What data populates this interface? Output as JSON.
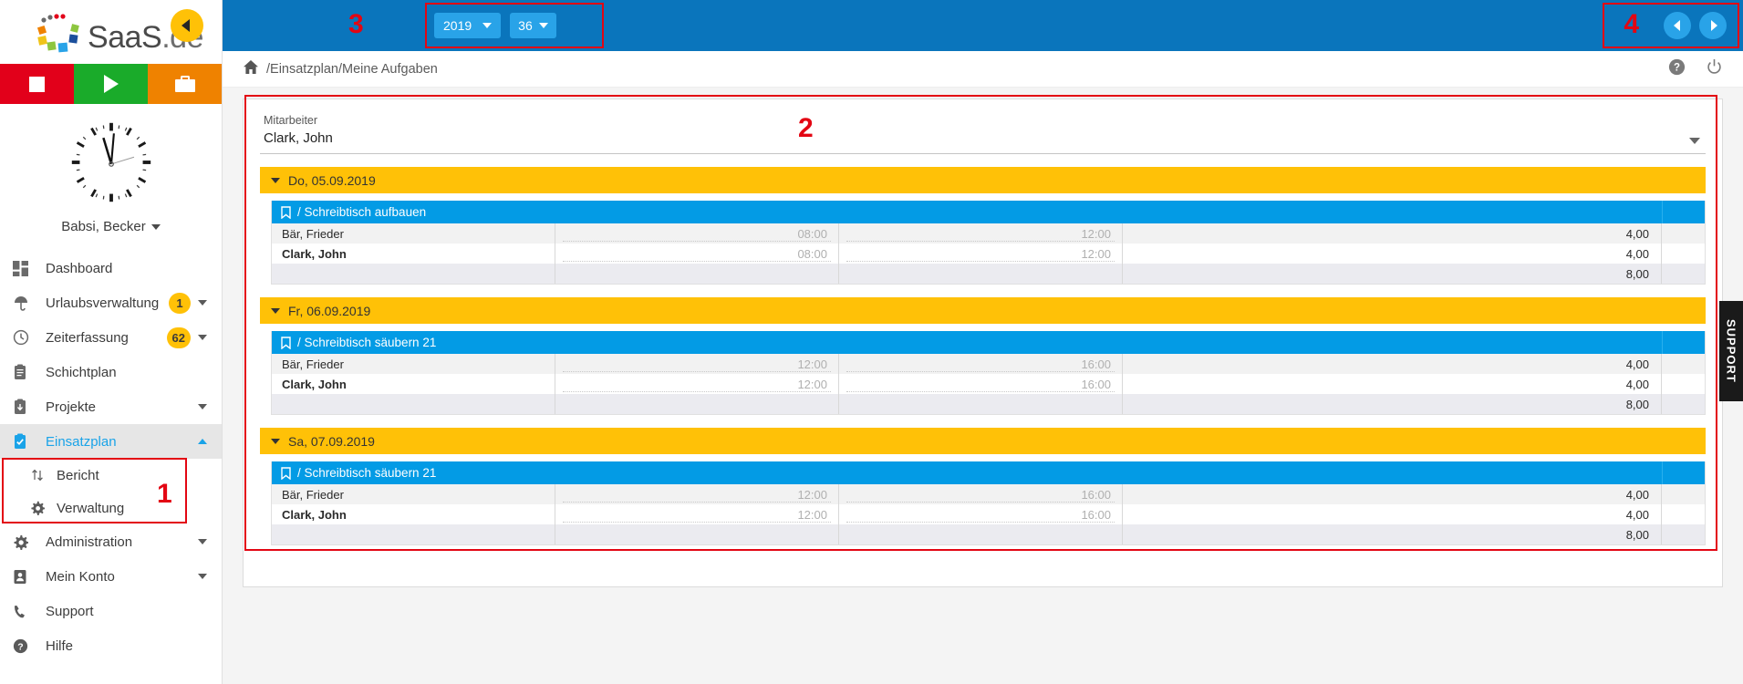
{
  "brand": {
    "name": "SaaS",
    "suffix": ".de"
  },
  "colors": {
    "topbar_blue": "#0a75bc",
    "select_blue": "#29a3e8",
    "accent_yellow": "#ffc107",
    "task_blue": "#039be5",
    "marker_red": "#e30613",
    "active_link": "#1aa3e8"
  },
  "action_bar": [
    {
      "name": "stop-button",
      "icon": "stop-icon",
      "color": "#e2001a"
    },
    {
      "name": "play-button",
      "icon": "play-icon",
      "color": "#1aab2a"
    },
    {
      "name": "briefcase-button",
      "icon": "briefcase-icon",
      "color": "#ef8200"
    }
  ],
  "user": {
    "name": "Babsi, Becker"
  },
  "sidebar": {
    "items": [
      {
        "label": "Dashboard",
        "icon": "dashboard-icon",
        "badge": null,
        "caret": null,
        "active": false
      },
      {
        "label": "Urlaubsverwaltung",
        "icon": "umbrella-icon",
        "badge": "1",
        "caret": "down",
        "active": false
      },
      {
        "label": "Zeiterfassung",
        "icon": "clock-icon",
        "badge": "62",
        "caret": "down",
        "active": false
      },
      {
        "label": "Schichtplan",
        "icon": "clipboard-icon",
        "badge": null,
        "caret": null,
        "active": false
      },
      {
        "label": "Projekte",
        "icon": "project-icon",
        "badge": null,
        "caret": "down",
        "active": false
      },
      {
        "label": "Einsatzplan",
        "icon": "check-clipboard-icon",
        "badge": null,
        "caret": "up",
        "active": true
      },
      {
        "label": "Administration",
        "icon": "gear-icon",
        "badge": null,
        "caret": "down",
        "active": false
      },
      {
        "label": "Mein Konto",
        "icon": "person-icon",
        "badge": null,
        "caret": "down",
        "active": false
      },
      {
        "label": "Support",
        "icon": "phone-icon",
        "badge": null,
        "caret": null,
        "active": false
      },
      {
        "label": "Hilfe",
        "icon": "help-icon",
        "badge": null,
        "caret": null,
        "active": false
      }
    ],
    "subitems": [
      {
        "label": "Bericht",
        "icon": "sort-icon"
      },
      {
        "label": "Verwaltung",
        "icon": "gear-icon"
      }
    ]
  },
  "topbar": {
    "year_value": "2019",
    "week_value": "36",
    "collapse_icon": "chevron-left-icon",
    "prev_icon": "chevron-left-icon",
    "next_icon": "chevron-right-icon"
  },
  "markers": {
    "m1": "1",
    "m2": "2",
    "m3": "3",
    "m4": "4"
  },
  "breadcrumb": {
    "home_icon": "home-icon",
    "path": "/Einsatzplan/Meine Aufgaben",
    "help_icon": "help-circle-icon",
    "power_icon": "power-icon"
  },
  "employee_select": {
    "label": "Mitarbeiter",
    "value": "Clark, John",
    "chevron": "chevron-down-icon"
  },
  "support_tab": {
    "label": "SUPPORT"
  },
  "day_groups": [
    {
      "date_label": "Do, 05.09.2019",
      "task": "/ Schreibtisch aufbauen",
      "rows": [
        {
          "name": "Bär, Frieder",
          "start": "08:00",
          "end": "12:00",
          "value": "4,00",
          "bold": false
        },
        {
          "name": "Clark, John",
          "start": "08:00",
          "end": "12:00",
          "value": "4,00",
          "bold": true
        }
      ],
      "sum": "8,00"
    },
    {
      "date_label": "Fr, 06.09.2019",
      "task": "/ Schreibtisch säubern 21",
      "rows": [
        {
          "name": "Bär, Frieder",
          "start": "12:00",
          "end": "16:00",
          "value": "4,00",
          "bold": false
        },
        {
          "name": "Clark, John",
          "start": "12:00",
          "end": "16:00",
          "value": "4,00",
          "bold": true
        }
      ],
      "sum": "8,00"
    },
    {
      "date_label": "Sa, 07.09.2019",
      "task": "/ Schreibtisch säubern 21",
      "rows": [
        {
          "name": "Bär, Frieder",
          "start": "12:00",
          "end": "16:00",
          "value": "4,00",
          "bold": false
        },
        {
          "name": "Clark, John",
          "start": "12:00",
          "end": "16:00",
          "value": "4,00",
          "bold": true
        }
      ],
      "sum": "8,00"
    }
  ]
}
